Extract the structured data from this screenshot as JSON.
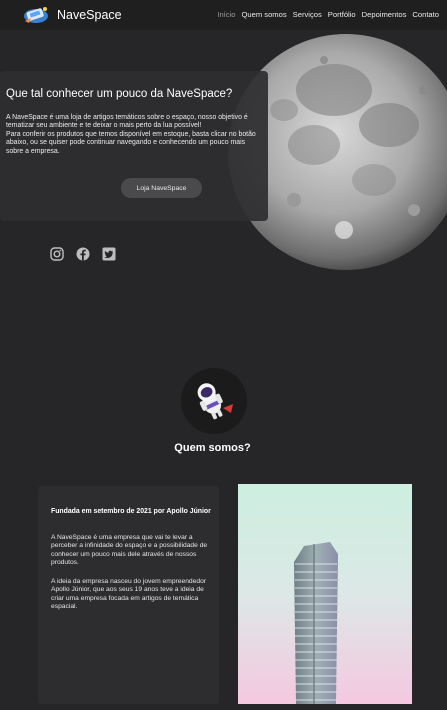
{
  "brand": {
    "name": "NaveSpace"
  },
  "nav": {
    "links": [
      {
        "label": "Início",
        "active": true
      },
      {
        "label": "Quem somos",
        "active": false
      },
      {
        "label": "Serviços",
        "active": false
      },
      {
        "label": "Portfólio",
        "active": false
      },
      {
        "label": "Depoimentos",
        "active": false
      },
      {
        "label": "Contato",
        "active": false
      }
    ]
  },
  "hero": {
    "title": "Que tal conhecer um pouco da NaveSpace?",
    "paragraph": "A NaveSpace é  uma loja de artigos temáticos sobre o espaço, nosso objetivo é tematizar seu ambiente e te deixar o mais perto da lua possível!\nPara conferir os produtos que temos disponível em estoque, basta clicar no botão abaixo, ou se quiser pode continuar navegando e conhecendo um pouco mais sobre a empresa.",
    "button_label": "Loja NaveSpace"
  },
  "social": {
    "icons": [
      "instagram-icon",
      "facebook-icon",
      "twitter-icon"
    ]
  },
  "about": {
    "heading": "Quem somos?",
    "founded": "Fundada em setembro de 2021 por Apollo Júnior",
    "paragraph_1": "A NaveSpace é uma empresa que vai te levar a perceber a infinidade do espaço e a possibilidade de conhecer um pouco mais dele através de nossos produtos.",
    "paragraph_2": "A ideia da empresa nasceu do jovem empreendedor Apollo Júnior, que aos seus 19 anos teve a ideia de criar uma empresa focada em artigos de temática espacial."
  },
  "colors": {
    "background": "#262628",
    "navbar": "#1f1f20",
    "card": "#2e2e30",
    "button": "#4a4a4c"
  }
}
